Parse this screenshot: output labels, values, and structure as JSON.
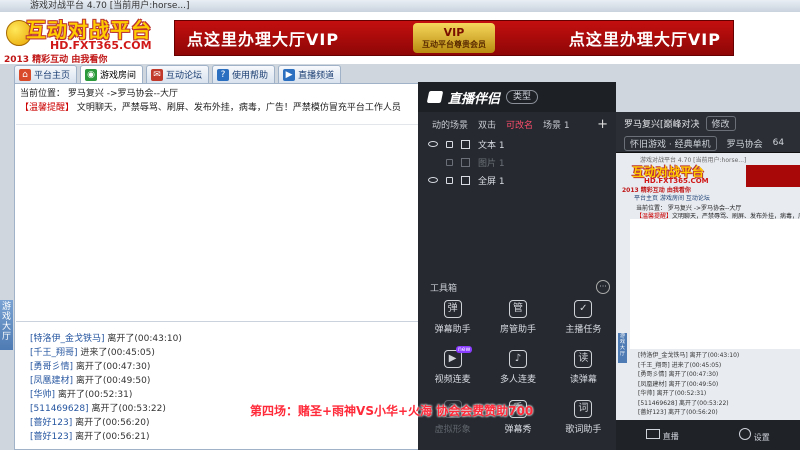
{
  "window": {
    "title": "游戏对战平台 4.70 [当前用户:horse...]"
  },
  "logo": {
    "brand": "互动对战平台",
    "url": "HD.FXT365.COM",
    "slogan": "2013 精彩互动 由我看你"
  },
  "banner": {
    "left_text": "点这里办理大厅VIP",
    "badge_top": "VIP",
    "badge_text": "互动平台尊贵会员",
    "right_text": "点这里办理大厅VIP"
  },
  "tabs": [
    {
      "label": "平台主页",
      "icon": "home-icon",
      "color": "#d84a2a"
    },
    {
      "label": "游戏房间",
      "icon": "game-icon",
      "color": "#2a9a3a"
    },
    {
      "label": "互动论坛",
      "icon": "forum-icon",
      "color": "#c0392b"
    },
    {
      "label": "使用帮助",
      "icon": "help-icon",
      "color": "#2b6fc0"
    },
    {
      "label": "直播频道",
      "icon": "live-icon",
      "color": "#2b6fc0"
    }
  ],
  "breadcrumb": "当前位置：  罗马复兴  ->罗马协会--大厅",
  "notice": {
    "tag": "【温馨提醒】",
    "text": "文明聊天，严禁辱骂、刷屏、发布外挂，病毒，广告！严禁模仿冒充平台工作人员"
  },
  "side_strip": "游戏大厅",
  "log": [
    {
      "name": "[特洛伊_金戈铁马]",
      "action": "离开了(00:43:10)"
    },
    {
      "name": "[千王_翔哥]",
      "action": "进来了(00:45:05)"
    },
    {
      "name": "[勇哥彡情]",
      "action": "离开了(00:47:30)"
    },
    {
      "name": "[凤凰建材]",
      "action": "离开了(00:49:50)"
    },
    {
      "name": "[华帅]",
      "action": "离开了(00:52:31)"
    },
    {
      "name": "[511469628]",
      "action": "离开了(00:53:22)"
    },
    {
      "name": "[蔷好123]",
      "action": "离开了(00:56:20)"
    },
    {
      "name": "[蔷好123]",
      "action": "离开了(00:56:21)"
    }
  ],
  "streamer": {
    "logo": "直播伴侣",
    "type_pill": "类型",
    "scene_tabs": [
      "动的场景",
      "双击",
      "可改名",
      "场景 1"
    ],
    "active_scene": "可改名",
    "sources": [
      {
        "label": "文本 1",
        "dim": false
      },
      {
        "label": "图片 1",
        "dim": true
      },
      {
        "label": "全屏 1",
        "dim": false
      }
    ],
    "toolbox_label": "工具箱",
    "tools": [
      {
        "label": "弹幕助手",
        "icon": "bullet-comment-icon",
        "glyph": "弹",
        "dim": false,
        "new": false
      },
      {
        "label": "房管助手",
        "icon": "admin-icon",
        "glyph": "管",
        "dim": false,
        "new": false
      },
      {
        "label": "主播任务",
        "icon": "task-icon",
        "glyph": "✓",
        "dim": false,
        "new": false
      },
      {
        "label": "视频连麦",
        "icon": "video-link-icon",
        "glyph": "▶",
        "dim": false,
        "new": true
      },
      {
        "label": "多人连麦",
        "icon": "multi-link-icon",
        "glyph": "♪",
        "dim": false,
        "new": false
      },
      {
        "label": "读弹幕",
        "icon": "read-comment-icon",
        "glyph": "读",
        "dim": false,
        "new": false
      },
      {
        "label": "虚拟形象",
        "icon": "avatar-icon",
        "glyph": "☺",
        "dim": true,
        "new": false
      },
      {
        "label": "弹幕秀",
        "icon": "comment-show-icon",
        "glyph": "秀",
        "dim": false,
        "new": false
      },
      {
        "label": "歌词助手",
        "icon": "lyrics-icon",
        "glyph": "词",
        "dim": false,
        "new": false
      }
    ],
    "new_badge": "new"
  },
  "preview_panel": {
    "title": "罗马复兴[巅峰对决",
    "edit_btn": "修改",
    "sub_category": "怀旧游戏 · 经典单机",
    "sub_room": "罗马协会",
    "sub_num": "64",
    "bottom_left": "直播",
    "bottom_right": "设置"
  },
  "caption": "第四场：赌圣+雨神VS小华+火海 协会会费赞助700"
}
